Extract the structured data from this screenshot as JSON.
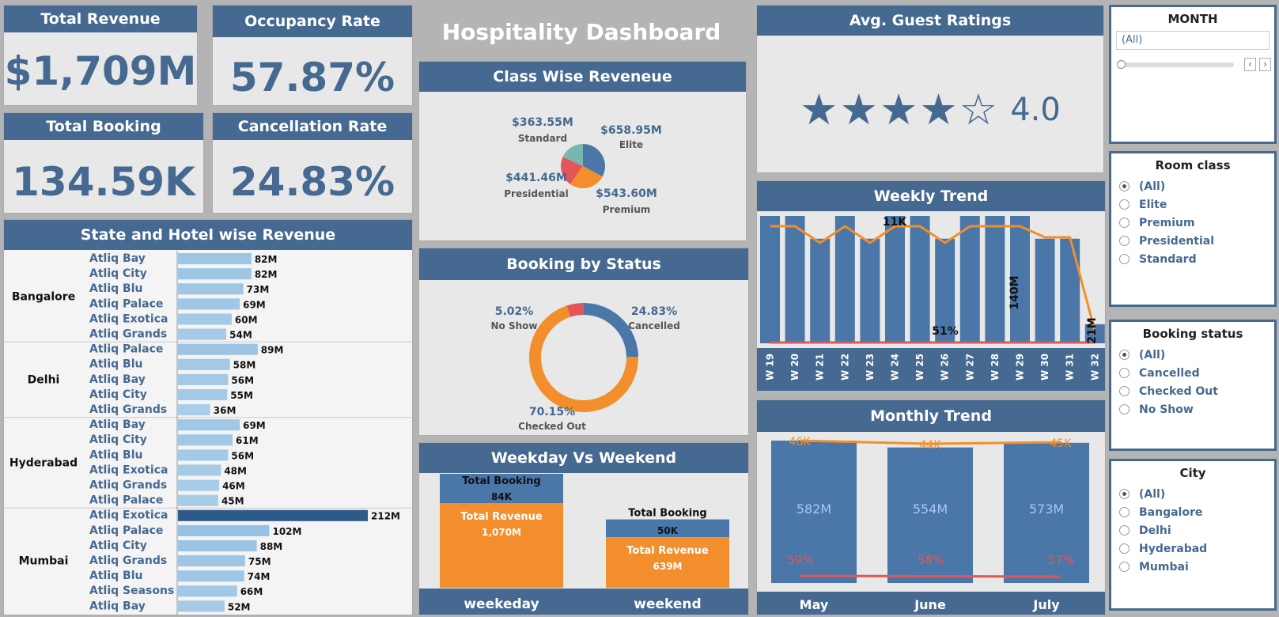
{
  "kpis": {
    "total_revenue": {
      "title": "Total Revenue",
      "value": "$1,709M"
    },
    "occupancy_rate": {
      "title": "Occupancy Rate",
      "value": "57.87%"
    },
    "total_booking": {
      "title": "Total Booking",
      "value": "134.59K"
    },
    "cancellation_rate": {
      "title": "Cancellation Rate",
      "value": "24.83%"
    }
  },
  "dashboard_title": "Hospitality Dashboard",
  "ratings": {
    "title": "Avg. Guest Ratings",
    "value": "4.0",
    "stars": 4,
    "max_stars": 5
  },
  "filters": {
    "month": {
      "title": "MONTH",
      "value": "(All)"
    },
    "room_class": {
      "title": "Room class",
      "options": [
        "(All)",
        "Elite",
        "Premium",
        "Presidential",
        "Standard"
      ],
      "selected": 0
    },
    "booking_status": {
      "title": "Booking status",
      "options": [
        "(All)",
        "Cancelled",
        "Checked Out",
        "No Show"
      ],
      "selected": 0
    },
    "city": {
      "title": "City",
      "options": [
        "(All)",
        "Bangalore",
        "Delhi",
        "Hyderabad",
        "Mumbai"
      ],
      "selected": 0
    }
  },
  "colors": {
    "header": "#456990",
    "bar": "#4a76a8",
    "orange": "#f28e2b",
    "red": "#e15759",
    "teal": "#76b7b2",
    "light_bar": "#9ec1e0"
  },
  "chart_data": [
    {
      "id": "state_hotel",
      "type": "bar",
      "title": "State and Hotel wise Revenue",
      "groups": [
        {
          "state": "Bangalore",
          "hotels": [
            "Atliq Bay",
            "Atliq City",
            "Atliq Blu",
            "Atliq Palace",
            "Atliq Exotica",
            "Atliq Grands"
          ],
          "values": [
            82,
            82,
            73,
            69,
            60,
            54
          ],
          "labels": [
            "82M",
            "82M",
            "73M",
            "69M",
            "60M",
            "54M"
          ]
        },
        {
          "state": "Delhi",
          "hotels": [
            "Atliq Palace",
            "Atliq Blu",
            "Atliq Bay",
            "Atliq City",
            "Atliq Grands"
          ],
          "values": [
            89,
            58,
            56,
            55,
            36
          ],
          "labels": [
            "89M",
            "58M",
            "56M",
            "55M",
            "36M"
          ]
        },
        {
          "state": "Hyderabad",
          "hotels": [
            "Atliq Bay",
            "Atliq City",
            "Atliq Blu",
            "Atliq Exotica",
            "Atliq Grands",
            "Atliq Palace"
          ],
          "values": [
            69,
            61,
            56,
            48,
            46,
            45
          ],
          "labels": [
            "69M",
            "61M",
            "56M",
            "48M",
            "46M",
            "45M"
          ]
        },
        {
          "state": "Mumbai",
          "hotels": [
            "Atliq Exotica",
            "Atliq Palace",
            "Atliq City",
            "Atliq Grands",
            "Atliq Blu",
            "Atliq Seasons",
            "Atliq Bay"
          ],
          "values": [
            212,
            102,
            88,
            75,
            74,
            66,
            52
          ],
          "labels": [
            "212M",
            "102M",
            "88M",
            "75M",
            "74M",
            "66M",
            "52M"
          ]
        }
      ]
    },
    {
      "id": "class_revenue",
      "type": "pie",
      "title": "Class Wise Reveneue",
      "slices": [
        {
          "name": "Elite",
          "value": 658.95,
          "label": "$658.95M"
        },
        {
          "name": "Premium",
          "value": 543.6,
          "label": "$543.60M"
        },
        {
          "name": "Presidential",
          "value": 441.46,
          "label": "$441.46M"
        },
        {
          "name": "Standard",
          "value": 363.55,
          "label": "$363.55M"
        }
      ]
    },
    {
      "id": "booking_status",
      "type": "pie",
      "title": "Booking by Status",
      "slices": [
        {
          "name": "Cancelled",
          "value": 24.83,
          "label": "24.83%"
        },
        {
          "name": "Checked Out",
          "value": 70.15,
          "label": "70.15%"
        },
        {
          "name": "No Show",
          "value": 5.02,
          "label": "5.02%"
        }
      ]
    },
    {
      "id": "weekday_weekend",
      "type": "bar",
      "title": "Weekday Vs Weekend",
      "categories": [
        "weekeday",
        "weekend"
      ],
      "series": [
        {
          "name": "Total Booking",
          "values": [
            84,
            50
          ],
          "labels": [
            "84K",
            "50K"
          ]
        },
        {
          "name": "Total Revenue",
          "values": [
            1070,
            639
          ],
          "labels": [
            "1,070M",
            "639M"
          ]
        }
      ]
    },
    {
      "id": "weekly_trend",
      "type": "bar",
      "title": "Weekly Trend",
      "categories": [
        "W 19",
        "W 20",
        "W 21",
        "W 22",
        "W 23",
        "W 24",
        "W 25",
        "W 26",
        "W 27",
        "W 28",
        "W 29",
        "W 30",
        "W 31",
        "W 32"
      ],
      "series": [
        {
          "name": "revenue",
          "values": [
            140,
            140,
            115,
            140,
            115,
            140,
            140,
            115,
            140,
            140,
            140,
            115,
            115,
            21
          ]
        },
        {
          "name": "bookings",
          "values": [
            11,
            11,
            9.5,
            11,
            9.5,
            11,
            11,
            9.5,
            11,
            11,
            11,
            10,
            10,
            1.5
          ]
        },
        {
          "name": "occupancy",
          "values": [
            51,
            51,
            51,
            51,
            51,
            51,
            51,
            51,
            51,
            51,
            51,
            51,
            51,
            51
          ]
        }
      ],
      "annotations": [
        "11K",
        "140M",
        "51%",
        "21M"
      ]
    },
    {
      "id": "monthly_trend",
      "type": "bar",
      "title": "Monthly Trend",
      "categories": [
        "May",
        "June",
        "July"
      ],
      "series": [
        {
          "name": "revenue",
          "values": [
            582,
            554,
            573
          ],
          "labels": [
            "582M",
            "554M",
            "573M"
          ]
        },
        {
          "name": "bookings",
          "values": [
            46,
            44,
            45
          ],
          "labels": [
            "46K",
            "44K",
            "45K"
          ]
        },
        {
          "name": "occupancy",
          "values": [
            59,
            58,
            57
          ],
          "labels": [
            "59%",
            "58%",
            "57%"
          ]
        }
      ]
    }
  ]
}
